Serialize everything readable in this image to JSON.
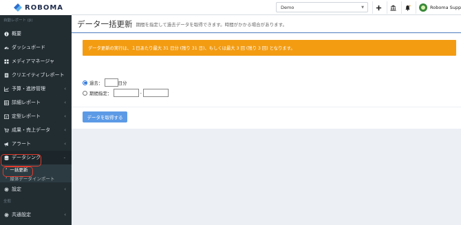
{
  "header": {
    "logo_text": "ROBOMA",
    "org_select_value": "Demo",
    "user_name": "Roboma Support"
  },
  "sidebar": {
    "section_auto_report": "自動レポート (β)",
    "section_global": "全般",
    "items": [
      {
        "label": "概要",
        "icon": "info-circle-icon"
      },
      {
        "label": "ダッシュボード",
        "icon": "dashboard-icon"
      },
      {
        "label": "メディアマネージャ",
        "icon": "grid-icon"
      },
      {
        "label": "クリエイティブレポート",
        "icon": "file-icon"
      },
      {
        "label": "予算・進捗管理",
        "icon": "line-chart-icon"
      },
      {
        "label": "詳細レポート",
        "icon": "table-icon"
      },
      {
        "label": "定型レポート",
        "icon": "report-icon"
      },
      {
        "label": "成果・売上データ",
        "icon": "cart-icon"
      },
      {
        "label": "アラート",
        "icon": "megaphone-icon"
      },
      {
        "label": "データシンク",
        "icon": "database-icon"
      },
      {
        "label": "設定",
        "icon": "gear-icon"
      },
      {
        "label": "共通設定",
        "icon": "gear-icon"
      }
    ],
    "sub_items": [
      {
        "label": "一括更新"
      },
      {
        "label": "媒体データインポート"
      }
    ]
  },
  "main": {
    "page_title": "データ一括更新",
    "page_subtitle": "期間を指定して過去データを取得できます。時間がかかる場合があります。",
    "alert_text": "データ更新の実行は、１日あたり最大 31 日分 (残り 31 日)、もしくは最大 3 回 (残り 3 回) となります。",
    "option_past_label": "過去：",
    "option_past_unit": "日分",
    "option_past_value": "",
    "option_period_label": "期間指定：",
    "period_from": "",
    "period_to": "",
    "period_separator": "-",
    "submit_label": "データを取得する"
  },
  "colors": {
    "sidebar_bg": "#222d32",
    "alert_bg": "#f39c12",
    "primary_button": "#5c9ae6",
    "highlight": "#e23b2e"
  }
}
